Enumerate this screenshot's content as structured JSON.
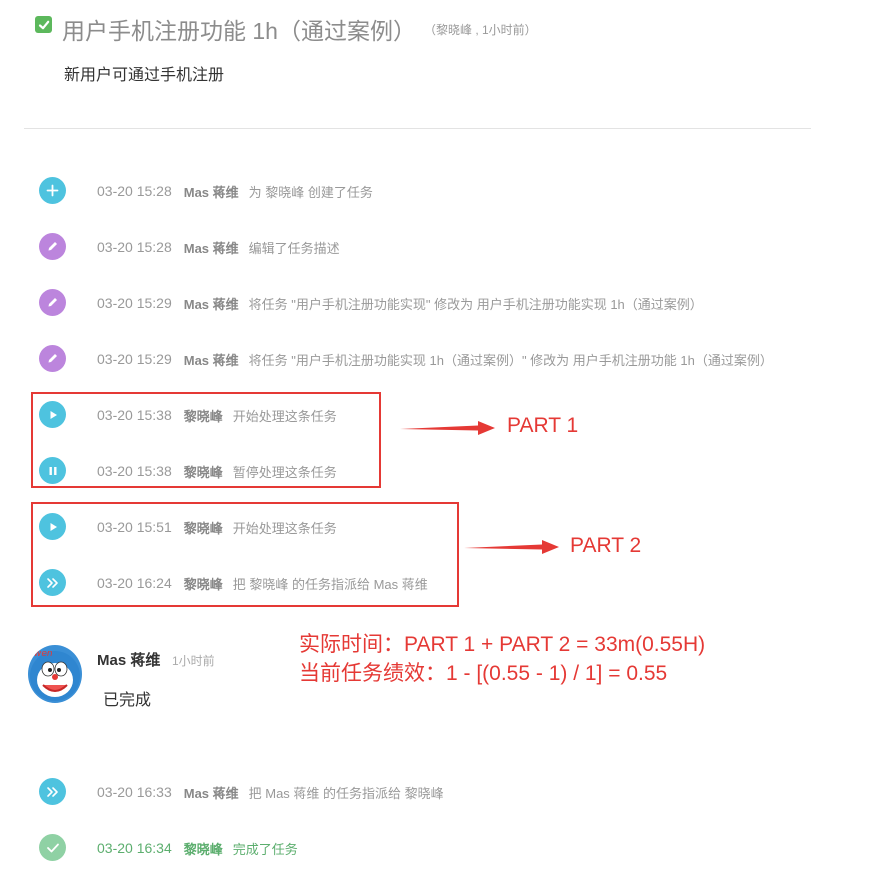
{
  "task": {
    "title": "用户手机注册功能 1h（通过案例）",
    "meta": "（黎晓峰 , 1小时前）",
    "description": "新用户可通过手机注册"
  },
  "activities": [
    {
      "icon": "plus-icon",
      "time": "03-20 15:28",
      "user": "Mas 蒋维",
      "text": "为 黎晓峰 创建了任务"
    },
    {
      "icon": "pencil-icon",
      "time": "03-20 15:28",
      "user": "Mas 蒋维",
      "text": "编辑了任务描述"
    },
    {
      "icon": "pencil-icon",
      "time": "03-20 15:29",
      "user": "Mas 蒋维",
      "text": "将任务 \"用户手机注册功能实现\" 修改为 用户手机注册功能实现 1h（通过案例）"
    },
    {
      "icon": "pencil-icon",
      "time": "03-20 15:29",
      "user": "Mas 蒋维",
      "text": "将任务 \"用户手机注册功能实现 1h（通过案例）\" 修改为 用户手机注册功能 1h（通过案例）"
    },
    {
      "icon": "play-icon",
      "time": "03-20 15:38",
      "user": "黎晓峰",
      "text": "开始处理这条任务"
    },
    {
      "icon": "pause-icon",
      "time": "03-20 15:38",
      "user": "黎晓峰",
      "text": "暂停处理这条任务"
    },
    {
      "icon": "play-icon",
      "time": "03-20 15:51",
      "user": "黎晓峰",
      "text": "开始处理这条任务"
    },
    {
      "icon": "forward-icon",
      "time": "03-20 16:24",
      "user": "黎晓峰",
      "text": "把 黎晓峰 的任务指派给 Mas 蒋维"
    },
    {
      "icon": "forward-icon",
      "time": "03-20 16:33",
      "user": "Mas 蒋维",
      "text": "把 Mas 蒋维 的任务指派给 黎晓峰"
    },
    {
      "icon": "check-circle-icon",
      "time": "03-20 16:34",
      "user": "黎晓峰",
      "text": "完成了任务"
    }
  ],
  "comment": {
    "avatar_text": "wen",
    "author": "Mas 蒋维",
    "time": "1小时前",
    "body": "已完成"
  },
  "annotations": {
    "part1_label": "PART 1",
    "part2_label": "PART 2",
    "note_line1": "实际时间：PART 1 + PART 2 = 33m(0.55H)",
    "note_line2": "当前任务绩效：1 - [(0.55 - 1) / 1] = 0.55",
    "color": "#e53935"
  }
}
